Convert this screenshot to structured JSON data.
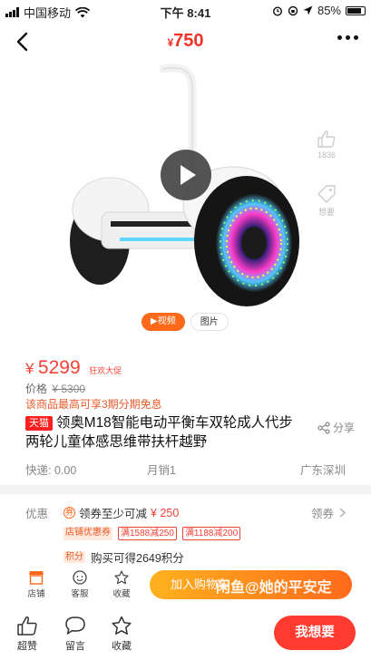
{
  "status_bar": {
    "carrier": "中国移动",
    "time": "下午 8:41",
    "battery": "85%",
    "battery_level": 0.85
  },
  "header": {
    "price_symbol": "¥",
    "price": "750"
  },
  "gallery": {
    "like_count": "1836",
    "want_label": "想要",
    "video_tab": "▶视频",
    "image_tab": "图片"
  },
  "product": {
    "price_symbol": "¥",
    "price": "5299",
    "promo_label": "狂欢大促",
    "orig_label": "价格",
    "orig_price": "¥ 5300",
    "install_note": "该商品最高可享3期分期免息",
    "shop_badge": "天猫",
    "title": "领奥M18智能电动平衡车双轮成人代步两轮儿童体感思维带扶杆越野",
    "share_label": "分享",
    "shipping": "快递: 0.00",
    "monthly_sales": "月销1",
    "location": "广东深圳"
  },
  "deals": {
    "label": "优惠",
    "coupon_icon": "券",
    "coupon_text": "领券至少可减",
    "coupon_amount": "¥ 250",
    "get_coupon": "领券",
    "tags": [
      "店铺优惠券",
      "满1588减250",
      "满1188减200"
    ],
    "points_label": "积分",
    "points_text": "购买可得2649积分"
  },
  "actions_row1": {
    "store": "店铺",
    "service": "客服",
    "favorite": "收藏",
    "add_to_cart": "加入购物车"
  },
  "watermark": "闲鱼@她的平安定",
  "actions_row2": {
    "like": "超赞",
    "comment": "留言",
    "favorite": "收藏",
    "want": "我想要"
  },
  "colors": {
    "accent": "#f44236",
    "orange": "#ff6a1a",
    "want_button": "#ff3b30"
  }
}
